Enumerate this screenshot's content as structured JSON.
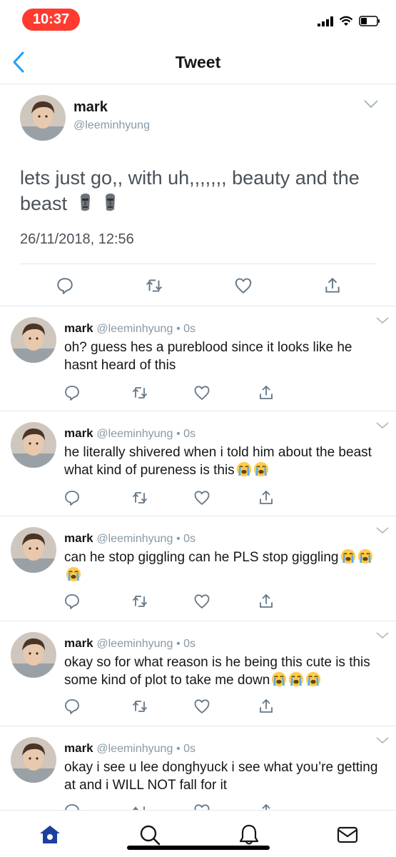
{
  "status_bar": {
    "time": "10:37"
  },
  "nav": {
    "title": "Tweet"
  },
  "main_tweet": {
    "name": "mark",
    "handle": "@leeminhyung",
    "text": "lets just go,, with uh,,,,,,, beauty and the beast",
    "emoji": [
      "moai-emoji",
      "moai-emoji"
    ],
    "timestamp": "26/11/2018, 12:56"
  },
  "replies": [
    {
      "name": "mark",
      "handle": "@leeminhyung",
      "time": "• 0s",
      "text": "oh? guess hes a pureblood since it looks like he hasnt heard of this"
    },
    {
      "name": "mark",
      "handle": "@leeminhyung",
      "time": "• 0s",
      "text": "he literally shivered when i told him about the beast what kind of pureness is this",
      "emoji_count": 2
    },
    {
      "name": "mark",
      "handle": "@leeminhyung",
      "time": "• 0s",
      "text": "can he stop giggling can he PLS stop giggling",
      "emoji_count": 3
    },
    {
      "name": "mark",
      "handle": "@leeminhyung",
      "time": "• 0s",
      "text": "okay so for what reason is he being this cute is this some kind of plot to take me down",
      "emoji_count": 3
    },
    {
      "name": "mark",
      "handle": "@leeminhyung",
      "time": "• 0s",
      "text": "okay i see u lee donghyuck i see what you’re getting at and i WILL NOT fall for it"
    }
  ],
  "tab_bar": {
    "items": [
      "home-icon",
      "search-icon",
      "notifications-icon",
      "messages-icon"
    ]
  },
  "colors": {
    "accent": "#1da1f2",
    "status_red": "#ff3b30",
    "secondary_text": "#8899a6",
    "border": "#e1e8ed",
    "home_active": "#1d3f9e"
  }
}
